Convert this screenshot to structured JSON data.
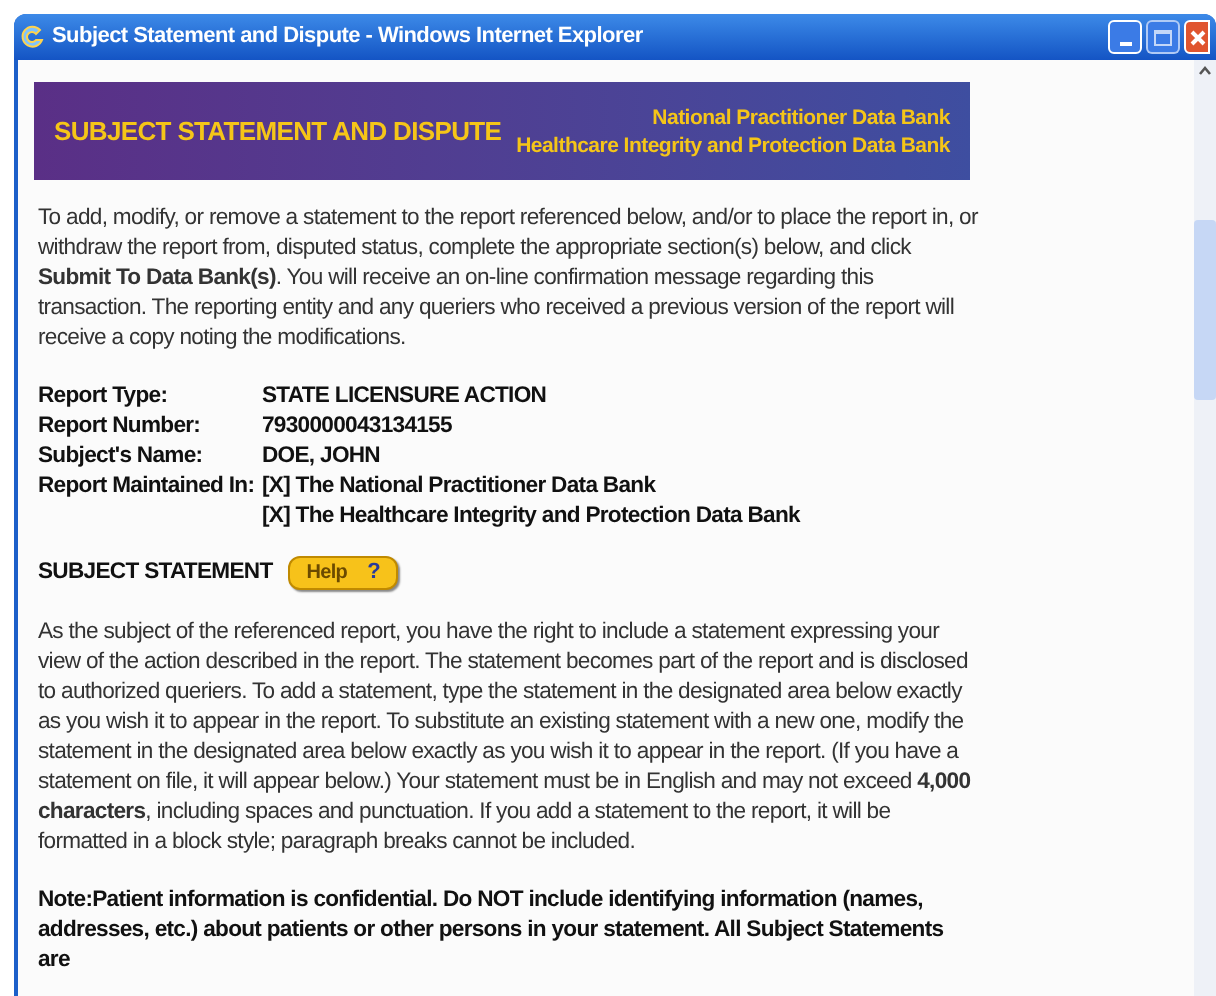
{
  "window": {
    "title": "Subject Statement and Dispute - Windows Internet Explorer"
  },
  "banner": {
    "title": "SUBJECT STATEMENT AND DISPUTE",
    "lines": [
      "National Practitioner Data Bank",
      "Healthcare Integrity and Protection Data Bank"
    ]
  },
  "intro": "To add, modify, or remove a statement to the report referenced below, and/or to place the report in, or withdraw the report from, disputed status, complete the appropriate section(s) below, and click **Submit To Data Bank(s)**. You will receive an on-line confirmation message regarding this transaction. The reporting entity and any queriers who received a previous version of the report will receive a copy noting the modifications.",
  "report": [
    {
      "label": "Report Type:",
      "values": [
        "STATE LICENSURE ACTION"
      ]
    },
    {
      "label": "Report Number:",
      "values": [
        "7930000043134155"
      ]
    },
    {
      "label": "Subject's Name:",
      "values": [
        "DOE, JOHN"
      ]
    },
    {
      "label": "Report Maintained In:",
      "values": [
        "[X] The National Practitioner Data Bank",
        "[X] The Healthcare Integrity and Protection Data Bank"
      ]
    }
  ],
  "subject_statement": {
    "heading": "SUBJECT STATEMENT",
    "help_button": {
      "label": "Help",
      "icon": "?"
    },
    "text": "As the subject of the referenced report, you have the right to include a statement expressing your view of the action described in the report. The statement becomes part of the report and is disclosed to authorized queriers. To add a statement, type the statement in the designated area below exactly as you wish it to appear in the report. To substitute an existing statement with a new one, modify the statement in the designated area below exactly as you wish it to appear in the report. (If you have a statement on file, it will appear below.) Your statement must be in English and may not exceed **4,000 characters**, including spaces and punctuation. If you add a statement to the report, it will be formatted in a block style; paragraph breaks cannot be included.",
    "note": "Note:Patient information is confidential. Do NOT include identifying information (names, addresses, etc.) about patients or other persons in your statement. All Subject Statements are"
  }
}
